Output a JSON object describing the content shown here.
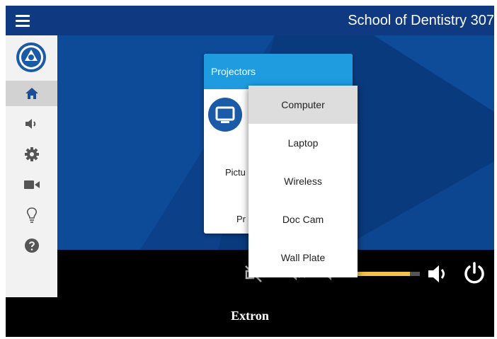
{
  "header": {
    "room_title": "School of Dentistry 307"
  },
  "sidebar": {
    "items": [
      {
        "icon": "home-icon",
        "active": true
      },
      {
        "icon": "volume-icon",
        "active": false
      },
      {
        "icon": "gear-icon",
        "active": false
      },
      {
        "icon": "camera-icon",
        "active": false
      },
      {
        "icon": "lightbulb-icon",
        "active": false
      },
      {
        "icon": "help-icon",
        "active": false
      }
    ]
  },
  "projectors_card": {
    "title": "Projectors",
    "picture_label": "Pictu",
    "power_label": "Pr"
  },
  "source_menu": {
    "options": [
      "Computer",
      "Laptop",
      "Wireless",
      "Doc Cam",
      "Wall Plate"
    ],
    "selected": "Computer"
  },
  "controls": {
    "volume_level_fraction": 0.85,
    "volume_bar_color": "#f2c14e"
  },
  "footer": {
    "brand": "Extron"
  },
  "colors": {
    "topbar": "#0f3a82",
    "accent": "#1f9ce0",
    "sidebar": "#f2f2f2"
  }
}
